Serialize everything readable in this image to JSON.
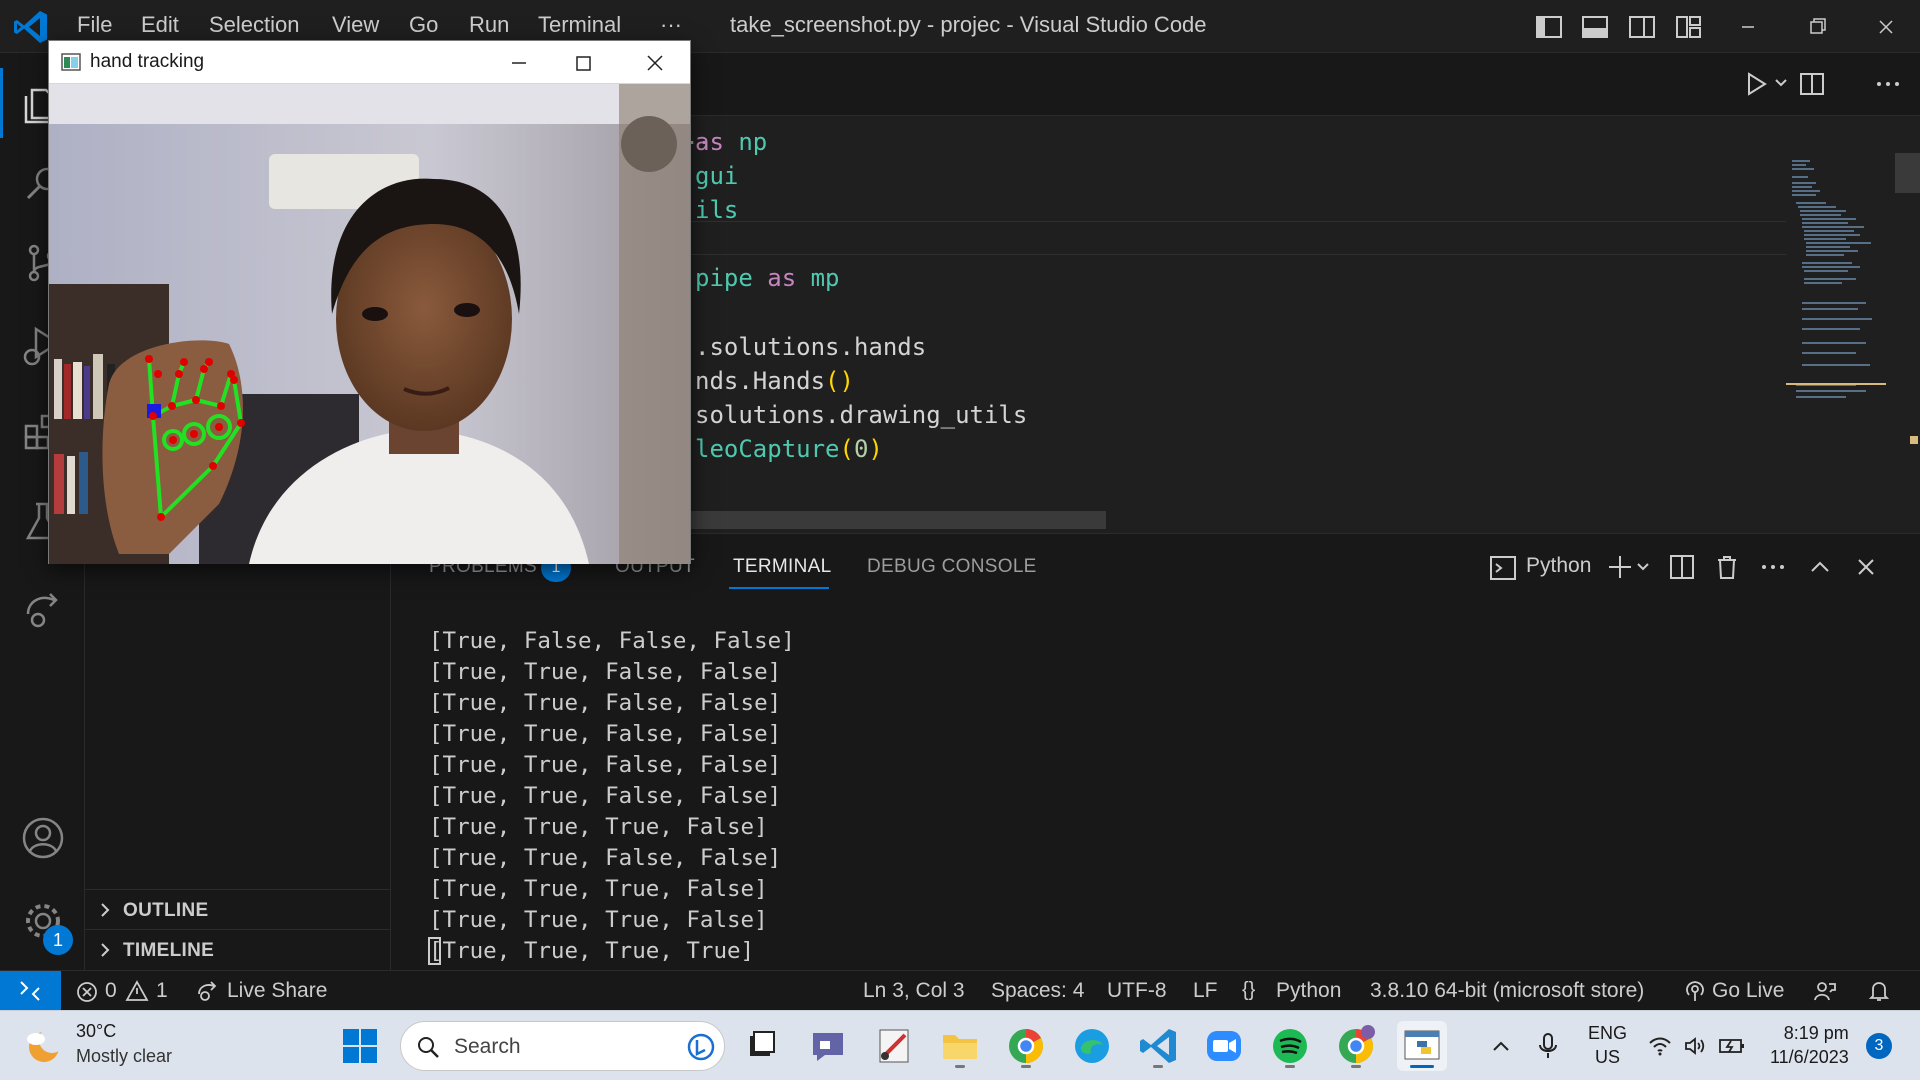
{
  "titlebar": {
    "menu": [
      "File",
      "Edit",
      "Selection",
      "View",
      "Go",
      "Run",
      "Terminal",
      "···"
    ],
    "title": "take_screenshot.py - projec - Visual Studio Code"
  },
  "activitybar": {
    "settings_badge": "1"
  },
  "sidebar": {
    "sections": [
      "OUTLINE",
      "TIMELINE"
    ]
  },
  "editor": {
    "breadcrumb": "..",
    "lines": [
      [
        {
          "t": "as ",
          "c": "kw"
        },
        {
          "t": "np",
          "c": "mod"
        }
      ],
      [
        {
          "t": "gui",
          "c": "mod"
        }
      ],
      [
        {
          "t": "ils",
          "c": "mod"
        }
      ],
      [],
      [
        {
          "t": "pipe ",
          "c": "mod"
        },
        {
          "t": "as ",
          "c": "kw"
        },
        {
          "t": "mp",
          "c": "mod"
        }
      ],
      [],
      [
        {
          "t": ".solutions.hands",
          "c": "txt"
        }
      ],
      [
        {
          "t": "nds.Hands",
          "c": "txt"
        },
        {
          "t": "()",
          "c": "paren"
        }
      ],
      [
        {
          "t": "solutions.drawing_utils",
          "c": "txt"
        }
      ],
      [
        {
          "t": "leoCapture",
          "c": "mod"
        },
        {
          "t": "(",
          "c": "paren"
        },
        {
          "t": "0",
          "c": "num"
        },
        {
          "t": ")",
          "c": "paren"
        }
      ]
    ]
  },
  "panel": {
    "tabs": {
      "problems": "PROBLEMS",
      "problems_count": "1",
      "output": "OUTPUT",
      "terminal": "TERMINAL",
      "debug_console": "DEBUG CONSOLE"
    },
    "terminal_profile": "Python",
    "terminal_lines": [
      "[True, False, False, False]",
      "[True, True, False, False]",
      "[True, True, False, False]",
      "[True, True, False, False]",
      "[True, True, False, False]",
      "[True, True, False, False]",
      "[True, True, True, False]",
      "[True, True, False, False]",
      "[True, True, True, False]",
      "[True, True, True, False]",
      "[True, True, True, True]"
    ]
  },
  "hand_window": {
    "title": "hand tracking"
  },
  "statusbar": {
    "errors": "0",
    "warnings": "1",
    "live_share": "Live Share",
    "position": "Ln 3, Col 3",
    "spaces": "Spaces: 4",
    "encoding": "UTF-8",
    "eol": "LF",
    "language": "Python",
    "interpreter": "3.8.10 64-bit (microsoft store)",
    "go_live": "Go Live"
  },
  "taskbar": {
    "weather_temp": "30°C",
    "weather_desc": "Mostly clear",
    "search_placeholder": "Search",
    "lang_top": "ENG",
    "lang_bottom": "US",
    "time": "8:19 pm",
    "date": "11/6/2023",
    "notification_count": "3"
  },
  "colors": {
    "accent": "#0078d4",
    "editor_bg": "#1f1f1f",
    "panel_bg": "#181818",
    "taskbar_bg": "#dde3ec",
    "landmark_line": "#22e022",
    "landmark_point": "#e00000"
  }
}
